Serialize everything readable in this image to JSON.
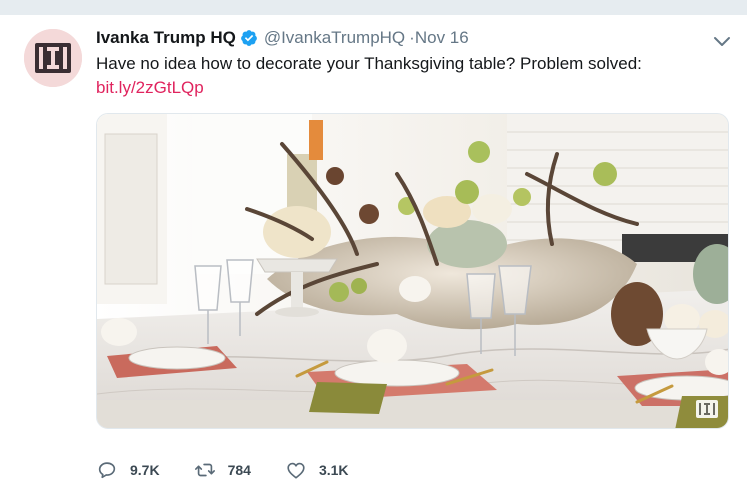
{
  "tweet": {
    "name": "Ivanka Trump HQ",
    "handle": "@IvankaTrumpHQ",
    "time_separator": "·",
    "time": "Nov 16",
    "text": "Have no idea how to decorate your Thanksgiving table? Problem solved:",
    "link": "bit.ly/2zGtLQp",
    "image_icon": "thanksgiving-table-photo",
    "watermark_icon": "ivanka-brand-logo-icon"
  },
  "actions": {
    "reply_count": "9.7K",
    "retweet_count": "784",
    "like_count": "3.1K"
  },
  "colors": {
    "verified": "#1da1f2",
    "link": "#e0245e",
    "muted": "#657786",
    "avatar_bg": "#f4d9d9"
  }
}
